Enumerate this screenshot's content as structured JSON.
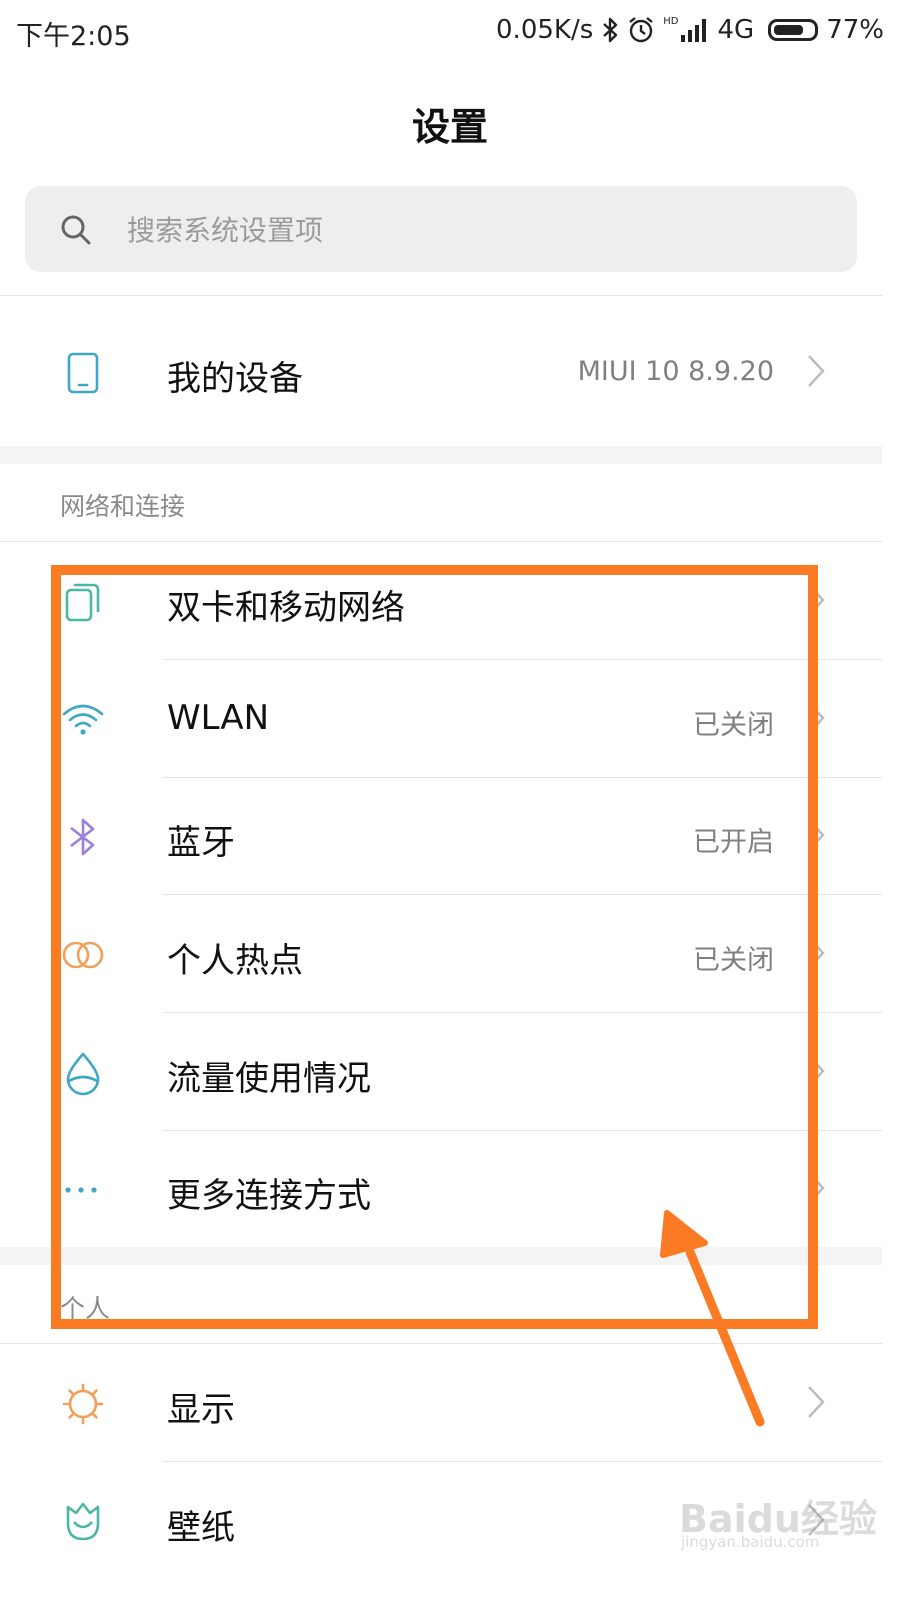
{
  "status_bar": {
    "time": "下午2:05",
    "net_speed": "0.05K/s",
    "hd_label": "HD",
    "network": "4G",
    "battery": "77%",
    "battery_level": 0.77,
    "icons": [
      "bluetooth-icon",
      "alarm-icon",
      "signal-icon",
      "battery-icon"
    ]
  },
  "page": {
    "title": "设置"
  },
  "search": {
    "placeholder": "搜索系统设置项",
    "icon": "search-icon"
  },
  "my_device": {
    "label": "我的设备",
    "value": "MIUI 10 8.9.20",
    "icon": "phone-icon",
    "icon_color": "#3fa7c4"
  },
  "network_section": {
    "header": "网络和连接",
    "items": [
      {
        "label": "双卡和移动网络",
        "value": "",
        "icon": "dual-sim-icon",
        "icon_color": "#4cb7a5"
      },
      {
        "label": "WLAN",
        "value": "已关闭",
        "icon": "wifi-icon",
        "icon_color": "#3fa7c4"
      },
      {
        "label": "蓝牙",
        "value": "已开启",
        "icon": "bluetooth-icon",
        "icon_color": "#9b7fd8"
      },
      {
        "label": "个人热点",
        "value": "已关闭",
        "icon": "hotspot-icon",
        "icon_color": "#f0a05a"
      },
      {
        "label": "流量使用情况",
        "value": "",
        "icon": "data-usage-icon",
        "icon_color": "#3fa7c4"
      },
      {
        "label": "更多连接方式",
        "value": "",
        "icon": "more-icon",
        "icon_color": "#3fa7c4"
      }
    ]
  },
  "personal_section": {
    "header": "个人",
    "items": [
      {
        "label": "显示",
        "icon": "brightness-icon",
        "icon_color": "#f0a05a"
      },
      {
        "label": "壁纸",
        "icon": "wallpaper-icon",
        "icon_color": "#4cb7a5"
      }
    ]
  },
  "annotation": {
    "color": "#fb7a24"
  },
  "watermark": {
    "main": "Baidu经验",
    "sub": "jingyan.baidu.com"
  }
}
